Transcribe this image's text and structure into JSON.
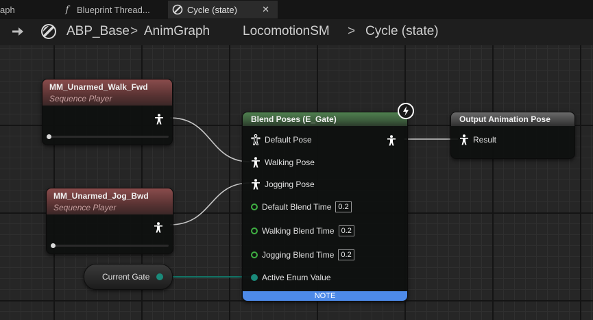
{
  "tabs": [
    {
      "label": "aph",
      "icon": "none"
    },
    {
      "label": "Blueprint Thread...",
      "icon": "function-icon"
    },
    {
      "label": "Cycle (state)",
      "icon": "state-icon",
      "close": "✕"
    }
  ],
  "breadcrumb": {
    "items": [
      "ABP_Base",
      "AnimGraph",
      "LocomotionSM",
      "Cycle (state)"
    ],
    "separator": ">"
  },
  "nodes": {
    "walk": {
      "title": "MM_Unarmed_Walk_Fwd",
      "subtitle": "Sequence Player"
    },
    "jog": {
      "title": "MM_Unarmed_Jog_Bwd",
      "subtitle": "Sequence Player"
    },
    "blend": {
      "title": "Blend Poses (E_Gate)",
      "pins": {
        "default_pose": "Default Pose",
        "walking_pose": "Walking Pose",
        "jogging_pose": "Jogging Pose",
        "default_blend_time": "Default Blend Time",
        "default_blend_value": "0.2",
        "walking_blend_time": "Walking Blend Time",
        "walking_blend_value": "0.2",
        "jogging_blend_time": "Jogging Blend Time",
        "jogging_blend_value": "0.2",
        "active_enum": "Active Enum Value"
      },
      "note": "NOTE"
    },
    "output": {
      "title": "Output Animation Pose",
      "result": "Result"
    },
    "variable": {
      "label": "Current Gate"
    }
  },
  "colors": {
    "pose_wire": "#c8c8c8",
    "enum_wire": "#0f7f70",
    "float_pin": "#3fb043",
    "note_bar": "#4d8ae8",
    "blend_header": "#4f7f4f",
    "sequence_header": "#8a4c4c"
  }
}
